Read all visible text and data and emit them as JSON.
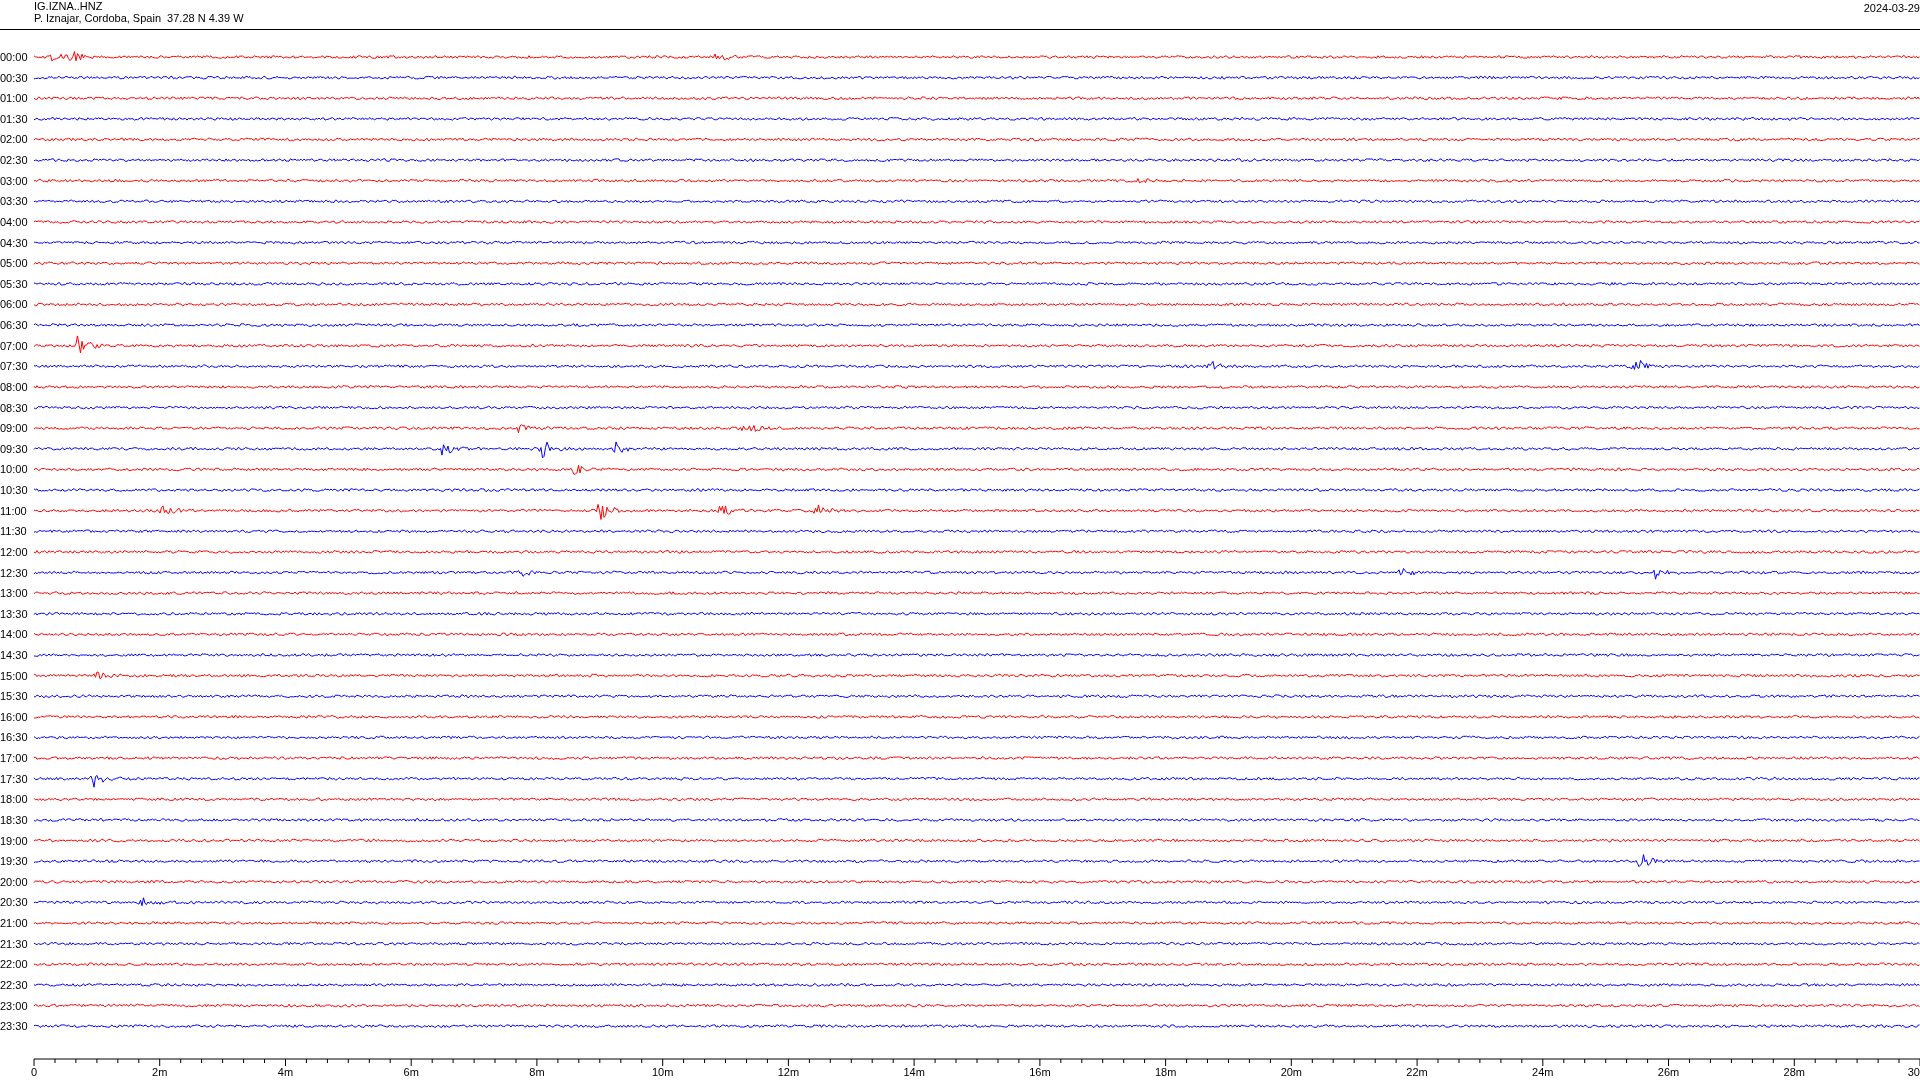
{
  "header": {
    "station": "IG.IZNA..HNZ",
    "location": "P. Iznajar, Cordoba, Spain  37.28 N 4.39 W",
    "date": "2024-03-29"
  },
  "traces": [
    {
      "label": "00:00",
      "color": "#ff0000"
    },
    {
      "label": "00:30",
      "color": "#0000ff"
    },
    {
      "label": "01:00",
      "color": "#ff0000"
    },
    {
      "label": "01:30",
      "color": "#0000ff"
    },
    {
      "label": "02:00",
      "color": "#ff0000"
    },
    {
      "label": "02:30",
      "color": "#0000ff"
    },
    {
      "label": "03:00",
      "color": "#ff0000"
    },
    {
      "label": "03:30",
      "color": "#0000ff"
    },
    {
      "label": "04:00",
      "color": "#ff0000"
    },
    {
      "label": "04:30",
      "color": "#0000ff"
    },
    {
      "label": "05:00",
      "color": "#ff0000"
    },
    {
      "label": "05:30",
      "color": "#0000ff"
    },
    {
      "label": "06:00",
      "color": "#ff0000"
    },
    {
      "label": "06:30",
      "color": "#0000ff"
    },
    {
      "label": "07:00",
      "color": "#ff0000"
    },
    {
      "label": "07:30",
      "color": "#0000ff"
    },
    {
      "label": "08:00",
      "color": "#ff0000"
    },
    {
      "label": "08:30",
      "color": "#0000ff"
    },
    {
      "label": "09:00",
      "color": "#ff0000"
    },
    {
      "label": "09:30",
      "color": "#0000ff"
    },
    {
      "label": "10:00",
      "color": "#ff0000"
    },
    {
      "label": "10:30",
      "color": "#0000ff"
    },
    {
      "label": "11:00",
      "color": "#ff0000"
    },
    {
      "label": "11:30",
      "color": "#0000ff"
    },
    {
      "label": "12:00",
      "color": "#ff0000"
    },
    {
      "label": "12:30",
      "color": "#0000ff"
    },
    {
      "label": "13:00",
      "color": "#ff0000"
    },
    {
      "label": "13:30",
      "color": "#0000ff"
    },
    {
      "label": "14:00",
      "color": "#ff0000"
    },
    {
      "label": "14:30",
      "color": "#0000ff"
    },
    {
      "label": "15:00",
      "color": "#ff0000"
    },
    {
      "label": "15:30",
      "color": "#0000ff"
    },
    {
      "label": "16:00",
      "color": "#ff0000"
    },
    {
      "label": "16:30",
      "color": "#0000ff"
    },
    {
      "label": "17:00",
      "color": "#ff0000"
    },
    {
      "label": "17:30",
      "color": "#0000ff"
    },
    {
      "label": "18:00",
      "color": "#ff0000"
    },
    {
      "label": "18:30",
      "color": "#0000ff"
    },
    {
      "label": "19:00",
      "color": "#ff0000"
    },
    {
      "label": "19:30",
      "color": "#0000ff"
    },
    {
      "label": "20:00",
      "color": "#ff0000"
    },
    {
      "label": "20:30",
      "color": "#0000ff"
    },
    {
      "label": "21:00",
      "color": "#ff0000"
    },
    {
      "label": "21:30",
      "color": "#0000ff"
    },
    {
      "label": "22:00",
      "color": "#ff0000"
    },
    {
      "label": "22:30",
      "color": "#0000ff"
    },
    {
      "label": "23:00",
      "color": "#ff0000"
    },
    {
      "label": "23:30",
      "color": "#0000ff"
    }
  ],
  "x_axis": {
    "labels": [
      "0",
      "2m",
      "4m",
      "6m",
      "8m",
      "10m",
      "12m",
      "14m",
      "16m",
      "18m",
      "20m",
      "22m",
      "24m",
      "26m",
      "28m",
      "30"
    ]
  }
}
